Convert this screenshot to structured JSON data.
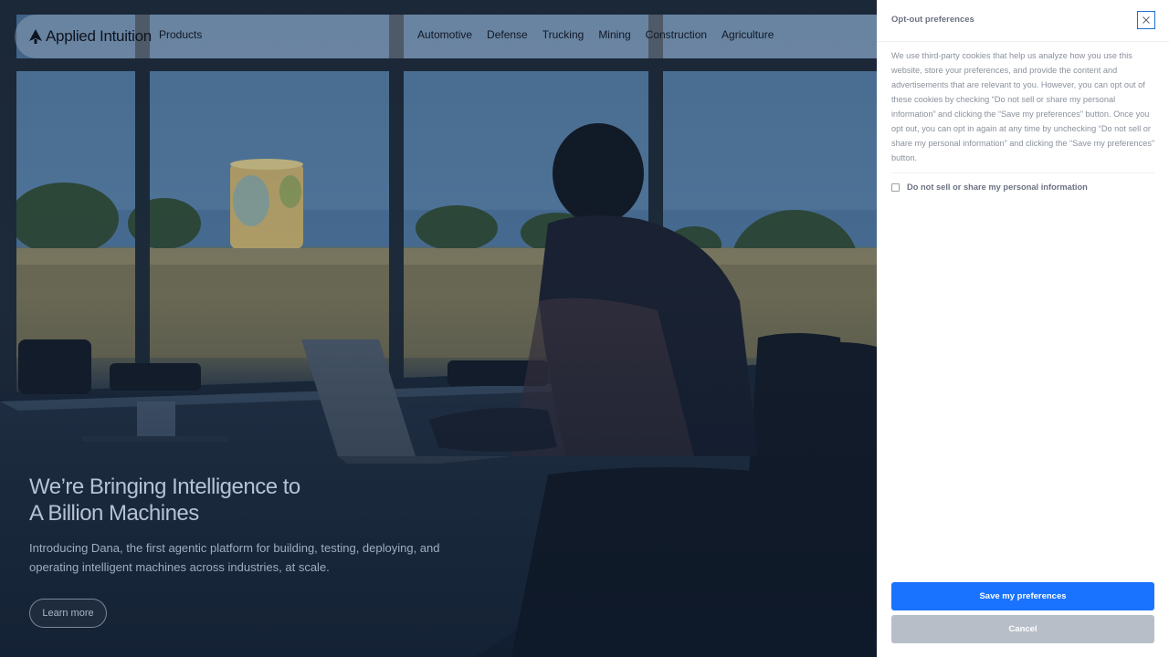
{
  "nav": {
    "brand": "Applied Intuition",
    "products": "Products",
    "links": [
      "Automotive",
      "Defense",
      "Trucking",
      "Mining",
      "Construction",
      "Agriculture"
    ]
  },
  "hero": {
    "headline_line1": "We’re Bringing Intelligence to",
    "headline_line2": "A Billion Machines",
    "subcopy": "Introducing Dana, the first agentic platform for building, testing, deploying, and operating intelligent machines across industries, at scale.",
    "cta": "Learn more"
  },
  "preferences": {
    "title": "Opt-out preferences",
    "body": "We use third-party cookies that help us analyze how you use this website, store your preferences, and provide the content and advertisements that are relevant to you. However, you can opt out of these cookies by checking “Do not sell or share my personal information” and clicking the “Save my preferences” button. Once you opt out, you can opt in again at any time by unchecking “Do not sell or share my personal information” and clicking the “Save my preferences” button.",
    "checkbox_label": "Do not sell or share my personal information",
    "checkbox_checked": false,
    "save_label": "Save my preferences",
    "cancel_label": "Cancel"
  },
  "colors": {
    "primary_button": "#1a73ff",
    "cancel_button": "#b7bec8",
    "close_border": "#1c6fd1"
  }
}
